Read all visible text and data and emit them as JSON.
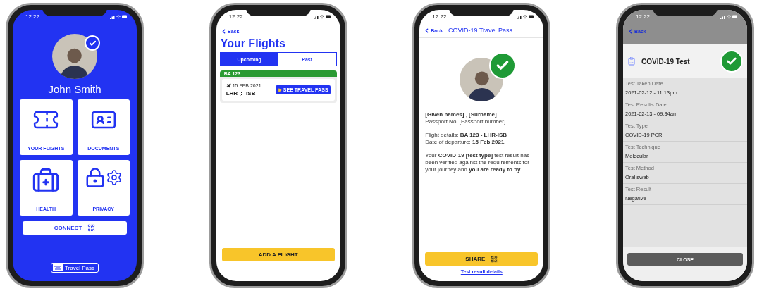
{
  "screens": [
    {
      "kind": "home",
      "status_time": "12:22",
      "verified": true,
      "user_name": "John Smith",
      "tiles": [
        {
          "kind": "flights",
          "label": "YOUR FLIGHTS"
        },
        {
          "kind": "documents",
          "label": "DOCUMENTS"
        },
        {
          "kind": "health",
          "label": "HEALTH"
        },
        {
          "kind": "privacy",
          "label": "PRIVACY"
        }
      ],
      "connect_button": "CONNECT",
      "logo_text": "Travel Pass"
    },
    {
      "kind": "flights",
      "status_time": "12:22",
      "back": "Back",
      "title": "Your Flights",
      "tabs": [
        {
          "label": "Upcoming",
          "selected": true
        },
        {
          "label": "Past",
          "selected": false
        }
      ],
      "flights": [
        {
          "flight_no": "BA 123",
          "date": "15 FEB 2021",
          "origin": "LHR",
          "destination": "ISB",
          "action": "SEE TRAVEL PASS"
        }
      ],
      "add_button": "ADD A FLIGHT"
    },
    {
      "kind": "pass",
      "status_time": "12:22",
      "back": "Back",
      "title": "COVID-19 Travel Pass",
      "verified": true,
      "holder_name": "[Given names] , [Surname]",
      "passport": "Passport No. [Passport number]",
      "flight": "Flight details: **BA 123 - LHR-ISB**",
      "departure": "Date of departure: **15 Feb 2021**",
      "message": "Your **COVID-19 [test type]** test result has been verified against the requirements for your journey and **you are ready to fly**.",
      "share_button": "SHARE",
      "details_link": "Test result details"
    },
    {
      "kind": "test",
      "status_time": "12:22",
      "back": "Back",
      "title": "COVID-19 Test",
      "passed": true,
      "fields": [
        {
          "label": "Test Taken Date",
          "value": "2021-02-12 - 11:13pm"
        },
        {
          "label": "Test Results Date",
          "value": "2021-02-13 - 09:34am"
        },
        {
          "label": "Test Type",
          "value": "COVID-19 PCR"
        },
        {
          "label": "Test Technique",
          "value": "Molecular"
        },
        {
          "label": "Test Method",
          "value": "Oral swab"
        },
        {
          "label": "Test Result",
          "value": "Negative"
        }
      ],
      "close_button": "CLOSE"
    }
  ]
}
